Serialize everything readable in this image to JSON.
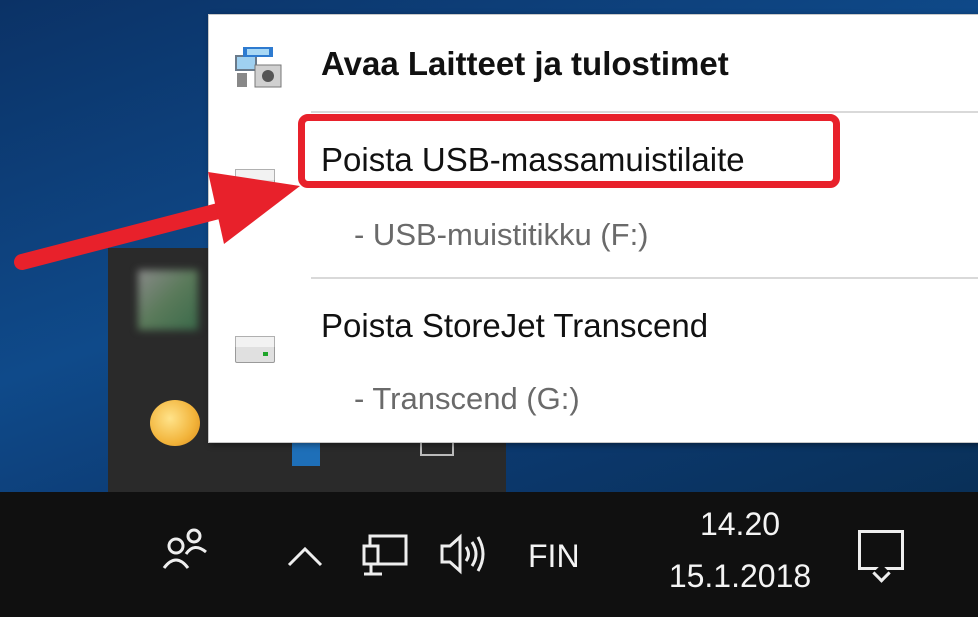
{
  "menu": {
    "open_devices_label": "Avaa Laitteet ja tulostimet",
    "eject_usb_label": "Poista USB-massamuistilaite",
    "usb_drive_sub": "-  USB-muistitikku (F:)",
    "eject_storejet_label": "Poista StoreJet Transcend",
    "storejet_sub": "-  Transcend (G:)"
  },
  "taskbar": {
    "language": "FIN",
    "time": "14.20",
    "date": "15.1.2018"
  },
  "icons": {
    "devices": "devices-printers-icon",
    "drive": "usb-drive-icon",
    "people": "people-icon",
    "chevron": "chevron-up-icon",
    "network": "network-icon",
    "volume": "volume-icon",
    "notifications": "action-center-icon"
  },
  "colors": {
    "highlight": "#e8212b",
    "arrow": "#e8212b",
    "taskbar": "#101010"
  }
}
